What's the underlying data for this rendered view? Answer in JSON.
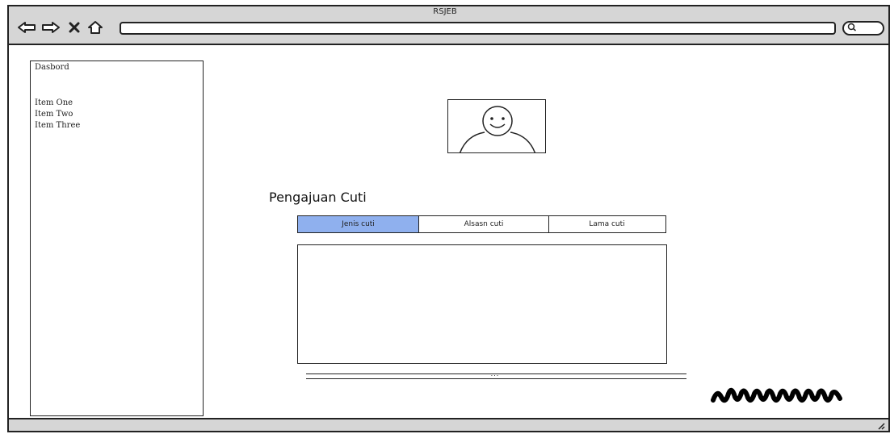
{
  "window": {
    "title": "RSJEB"
  },
  "nav": {
    "back_icon": "back-arrow-icon",
    "forward_icon": "forward-arrow-icon",
    "close_icon": "close-icon",
    "home_icon": "home-icon",
    "address_value": "",
    "search_icon": "search-icon"
  },
  "sidebar": {
    "heading": "Dasbord",
    "items": [
      {
        "label": "Item One"
      },
      {
        "label": "Item Two"
      },
      {
        "label": "Item Three"
      }
    ]
  },
  "main": {
    "avatar_icon": "user-avatar-icon",
    "title": "Pengajuan Cuti",
    "tabs": [
      {
        "label": "Jenis cuti",
        "active": true
      },
      {
        "label": "Alsasn cuti",
        "active": false
      },
      {
        "label": "Lama cuti",
        "active": false
      }
    ],
    "scroll_indicator": "..."
  },
  "colors": {
    "active_tab": "#8fb0ee",
    "chrome": "#d6d6d6",
    "border": "#222222"
  }
}
